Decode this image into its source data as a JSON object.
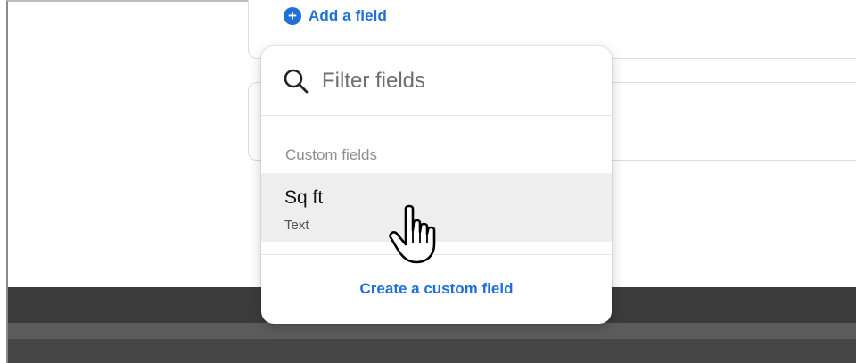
{
  "add_field": {
    "label": "Add a field",
    "icon": "plus-circle-icon"
  },
  "popover": {
    "search": {
      "placeholder": "Filter fields",
      "value": ""
    },
    "section_label": "Custom fields",
    "options": [
      {
        "name": "Sq ft",
        "type": "Text"
      }
    ],
    "create_link": "Create a custom field"
  },
  "colors": {
    "accent": "#1f6fd6",
    "option_hover": "#eeeeee"
  }
}
